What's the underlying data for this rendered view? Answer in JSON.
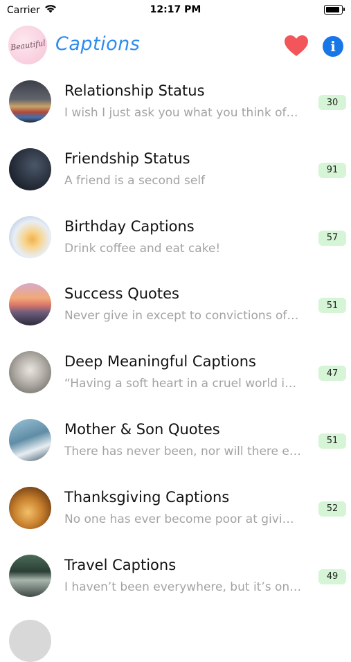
{
  "status_bar": {
    "carrier": "Carrier",
    "time": "12:17 PM"
  },
  "nav": {
    "logo_text": "Beautiful",
    "title": "Captions",
    "title_color": "#2d8cf0",
    "heart_icon": "heart-icon",
    "heart_color": "#f2555a",
    "info_icon": "info-icon",
    "info_color": "#1976e6"
  },
  "badge_color": "#d6f5d6",
  "categories": [
    {
      "title": "Relationship Status",
      "subtitle": "I wish I just ask you what you think of…",
      "count": "30"
    },
    {
      "title": "Friendship Status",
      "subtitle": "A friend is a second self",
      "count": "91"
    },
    {
      "title": "Birthday Captions",
      "subtitle": "Drink coffee and eat cake!",
      "count": "57"
    },
    {
      "title": "Success Quotes",
      "subtitle": "Never give in except to convictions of…",
      "count": "51"
    },
    {
      "title": "Deep Meaningful Captions",
      "subtitle": "“Having a soft heart in a cruel world i…",
      "count": "47"
    },
    {
      "title": "Mother & Son Quotes",
      "subtitle": "There has never been, nor will there e…",
      "count": "51"
    },
    {
      "title": "Thanksgiving Captions",
      "subtitle": "No one has ever become poor at givi…",
      "count": "52"
    },
    {
      "title": "Travel Captions",
      "subtitle": "I haven’t been everywhere, but it’s on…",
      "count": "49"
    }
  ]
}
